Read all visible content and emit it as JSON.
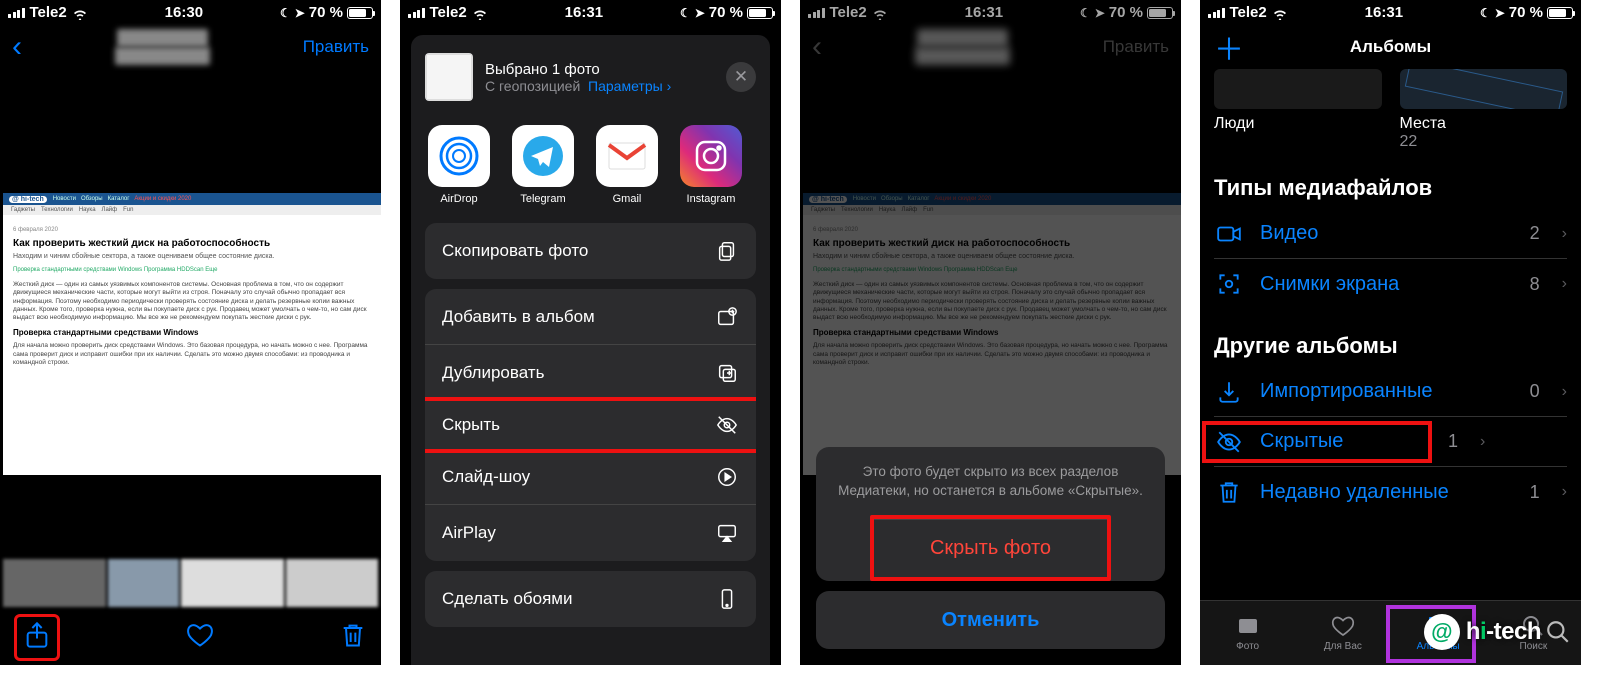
{
  "status": {
    "carrier": "Tele2",
    "time1": "16:30",
    "time2": "16:31",
    "batteryPct": "70 %"
  },
  "s1": {
    "edit": "Править"
  },
  "article": {
    "logo": "@ hi-tech",
    "nav": [
      "Новости",
      "Обзоры",
      "Каталог",
      "Акции и скидки 2020"
    ],
    "sub": [
      "Гаджеты",
      "Технологии",
      "Наука",
      "Лайф",
      "Fun"
    ],
    "date": "6 февраля 2020",
    "h1": "Как проверить жесткий диск на работоспособность",
    "lead": "Находим и чиним сбойные сектора, а также оцениваем общее состояние диска.",
    "links": "Проверка стандартными средствами Windows   Программа HDDScan   Еще",
    "p1": "Жесткий диск — один из самых уязвимых компонентов системы. Основная проблема в том, что он содержит движущиеся механические части, которые могут выйти из строя. Поначалу это случай обычно пропадает вся информация. Поэтому необходимо периодически проверять состояние диска и делать резервные копии важных данных. Кроме того, проверка нужна, если вы покупаете диск с рук. Продавец может умолчать о чем-то, но сам диск выдаст всю необходимую информацию. Мы все же не рекомендуем покупать жесткие диски с рук.",
    "h2": "Проверка стандартными средствами Windows",
    "p2": "Для начала можно проверить диск средствами Windows. Это базовая процедура, но начать можно с нее. Программа сама проверит диск и исправит ошибки при их наличии. Сделать это можно двумя способами: из проводника и командной строки."
  },
  "s2": {
    "selected": "Выбрано 1 фото",
    "geo": "С геопозицией",
    "params": "Параметры",
    "apps": {
      "airdrop": "AirDrop",
      "telegram": "Telegram",
      "gmail": "Gmail",
      "instagram": "Instagram"
    },
    "actions": {
      "copy": "Скопировать фото",
      "addAlbum": "Добавить в альбом",
      "dup": "Дублировать",
      "hide": "Скрыть",
      "slide": "Слайд-шоу",
      "airplay": "AirPlay",
      "wall": "Сделать обоями"
    }
  },
  "s3": {
    "msg": "Это фото будет скрыто из всех разделов Медиатеки, но останется в альбоме «Скрытые».",
    "hide": "Скрыть фото",
    "cancel": "Отменить"
  },
  "s4": {
    "title": "Альбомы",
    "people": "Люди",
    "places": "Места",
    "placesCount": "22",
    "sectTypes": "Типы медиафайлов",
    "video": "Видео",
    "videoCount": "2",
    "screenshots": "Снимки экрана",
    "screenshotsCount": "8",
    "sectOther": "Другие альбомы",
    "imported": "Импортированные",
    "importedCount": "0",
    "hidden": "Скрытые",
    "hiddenCount": "1",
    "deleted": "Недавно удаленные",
    "deletedCount": "1",
    "tabs": {
      "photo": "Фото",
      "forYou": "Для Вас",
      "albums": "Альбомы",
      "search": "Поиск"
    }
  }
}
